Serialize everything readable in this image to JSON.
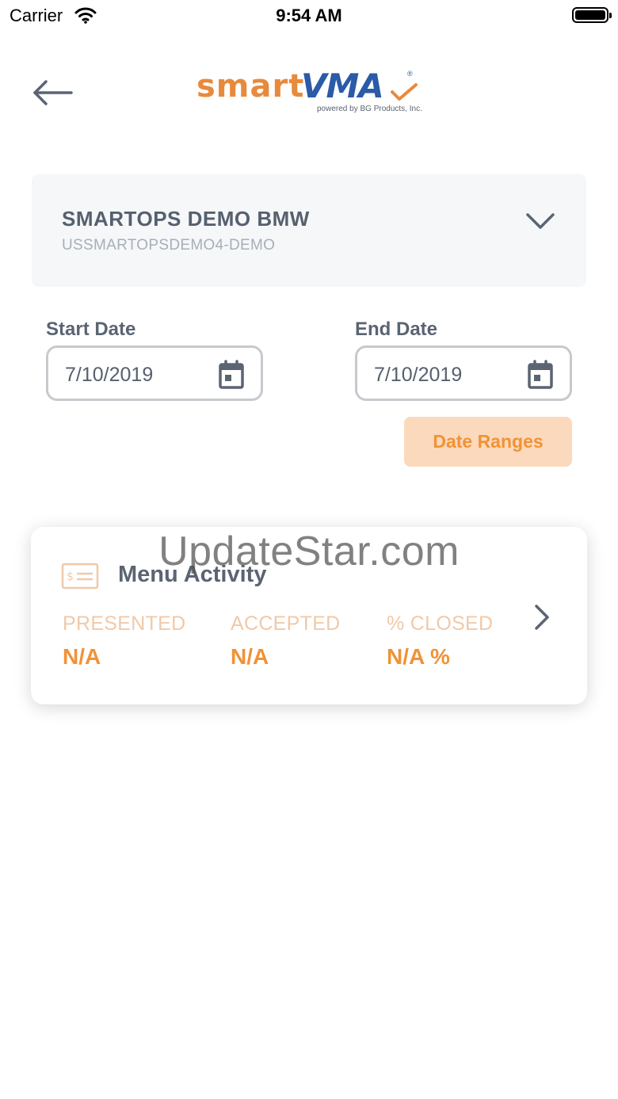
{
  "status_bar": {
    "carrier": "Carrier",
    "time": "9:54 AM"
  },
  "header": {
    "logo_smart": "smart",
    "logo_vma": "VMA",
    "logo_reg": "®",
    "logo_tagline": "powered by BG Products, Inc.",
    "back_icon": "arrow-left-icon"
  },
  "dealer": {
    "name": "SMARTOPS DEMO BMW",
    "code": "USSMARTOPSDEMO4-DEMO"
  },
  "dates": {
    "start_label": "Start Date",
    "start_value": "7/10/2019",
    "end_label": "End Date",
    "end_value": "7/10/2019",
    "ranges_button": "Date Ranges"
  },
  "menu_activity": {
    "title": "Menu Activity",
    "metrics": [
      {
        "label": "PRESENTED",
        "value": "N/A"
      },
      {
        "label": "ACCEPTED",
        "value": "N/A"
      },
      {
        "label": "% CLOSED",
        "value": "N/A %"
      }
    ]
  },
  "watermark": "UpdateStar.com",
  "colors": {
    "accent_orange": "#f19236",
    "button_bg": "#fbd9bd",
    "text_slate": "#56606e",
    "logo_blue": "#2a5aa8"
  }
}
